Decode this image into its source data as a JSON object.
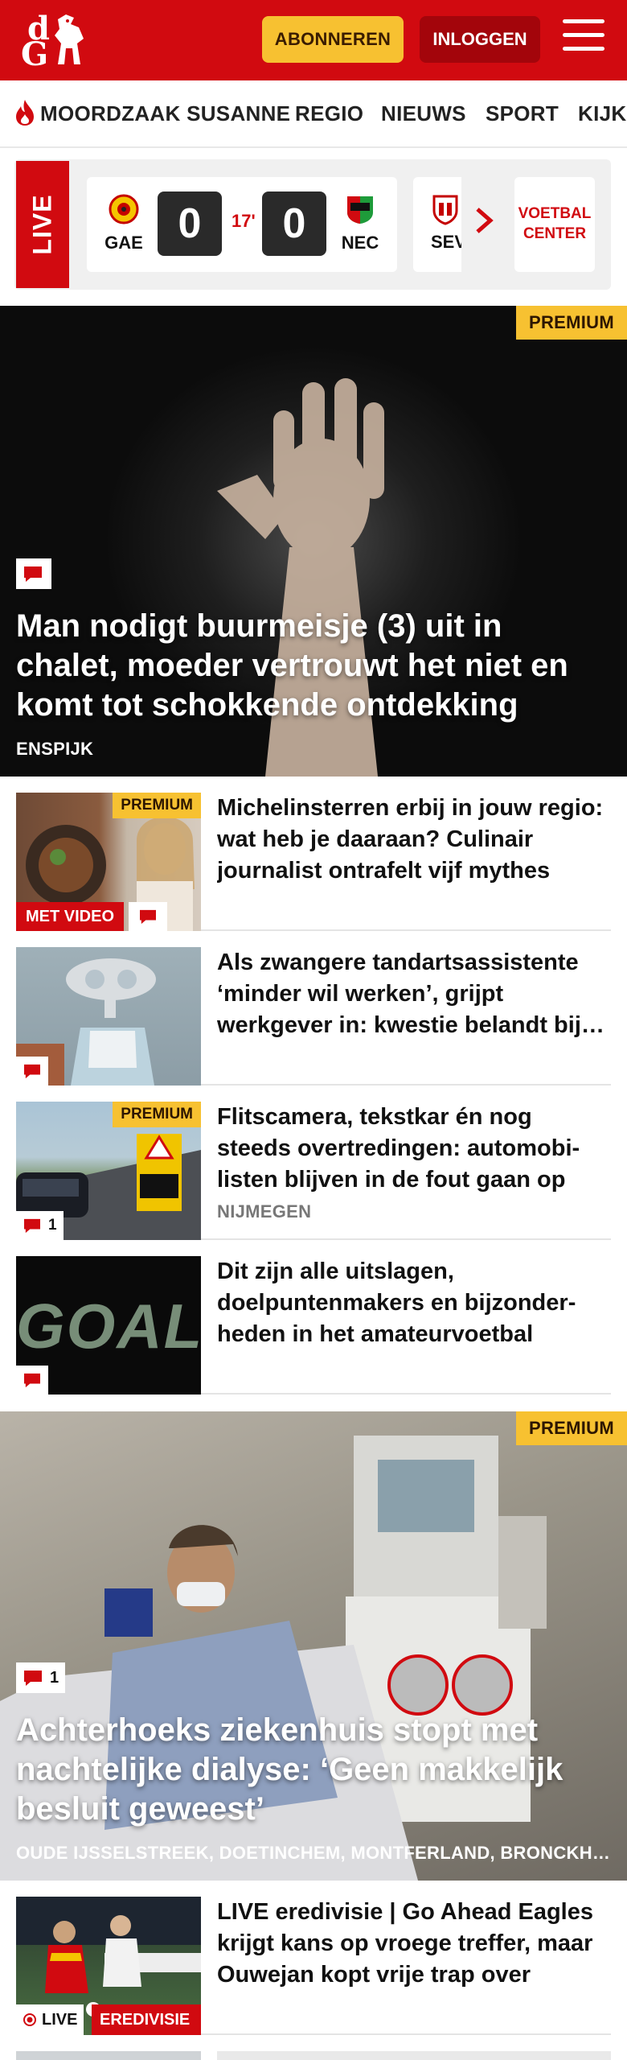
{
  "header": {
    "logo_top": "d",
    "logo_bottom": "G",
    "subscribe_label": "ABONNEREN",
    "login_label": "INLOGGEN"
  },
  "nav": {
    "items": [
      "MOORDZAAK SUSANNE",
      "REGIO",
      "NIEUWS",
      "SPORT",
      "KIJK"
    ]
  },
  "live": {
    "tab_label": "LIVE",
    "match": {
      "home": "GAE",
      "home_score": "0",
      "minute": "17'",
      "away_score": "0",
      "away": "NEC"
    },
    "next_match_home": "SEV",
    "center_label": "VOETBAL CENTER"
  },
  "hero1": {
    "premium": "PREMIUM",
    "title": "Man nodigt buurmeisje (3) uit in chalet, moeder vertrouwt het niet en komt tot schokkende ontdekking",
    "location": "ENSPIJK"
  },
  "articles": [
    {
      "title": "Michelinsterren erbij in jouw regio: wat heb je daaraan? Culinair journalist ontrafelt vijf mythes",
      "premium": "PREMIUM",
      "video_label": "MET VIDEO"
    },
    {
      "title": "Als zwangere tandartsassistente ‘minder wil werken’, grijpt werkgever in: kwestie belandt bij rechter"
    },
    {
      "title": "Flitscamera, tekstkar én nog steeds overtredingen: automobi­listen blijven in de fout gaan op deze weg",
      "premium": "PREMIUM",
      "comments": "1",
      "location": "NIJMEGEN"
    },
    {
      "title": "Dit zijn alle uitslagen, doelpuntenmakers en bijzonder­heden in het amateurvoetbal",
      "thumb_text": "GOAL!"
    }
  ],
  "hero2": {
    "premium": "PREMIUM",
    "comments": "1",
    "title": "Achterhoeks ziekenhuis stopt met nachtelijke dialyse: ‘Geen makkelijk besluit geweest’",
    "locations": "OUDE IJSSELSTREEK, DOETINCHEM, MONTFERLAND, BRONCKHORST"
  },
  "live_article": {
    "title": "LIVE eredivisie | Go Ahead Eagles krijgt kans op vroege treffer, maar Ouwejan kopt vrije trap over",
    "live_label": "LIVE",
    "category": "EREDIVISIE"
  },
  "colors": {
    "brand_red": "#d10a10",
    "premium_yellow": "#f7c131",
    "login_dark_red": "#a3050b"
  }
}
